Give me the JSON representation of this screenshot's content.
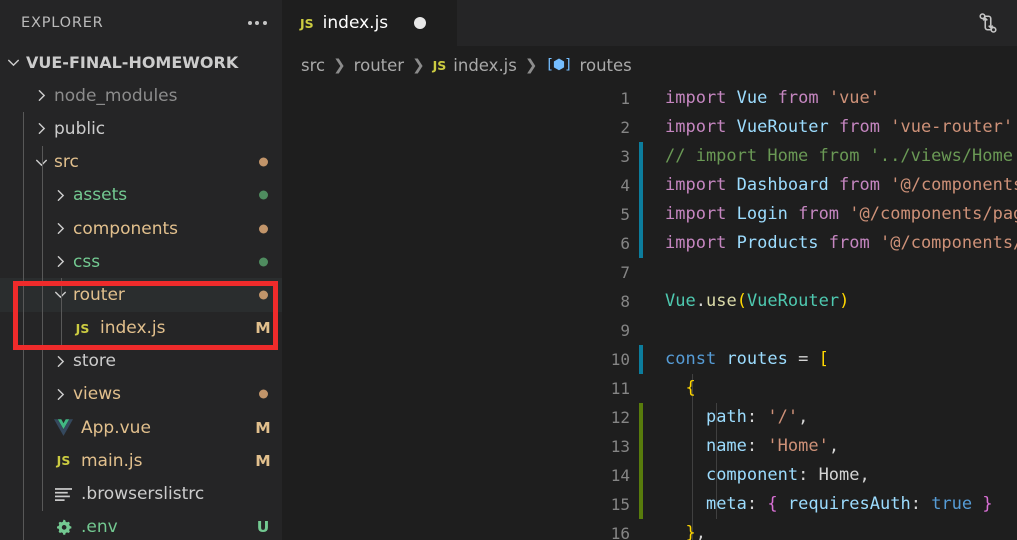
{
  "sidebar": {
    "title": "EXPLORER",
    "more_actions_label": "...",
    "root": {
      "label": "VUE-FINAL-HOMEWORK",
      "expanded": true
    },
    "items": [
      {
        "label": "node_modules",
        "type": "folder",
        "expanded": false,
        "indent": 1,
        "color": "#8c8c8c",
        "status": "",
        "dot": ""
      },
      {
        "label": "public",
        "type": "folder",
        "expanded": false,
        "indent": 1,
        "color": "#cccccc",
        "status": "",
        "dot": ""
      },
      {
        "label": "src",
        "type": "folder",
        "expanded": true,
        "indent": 1,
        "color": "#e2c08d",
        "status": "",
        "dot": "#c2956a"
      },
      {
        "label": "assets",
        "type": "folder",
        "expanded": false,
        "indent": 2,
        "color": "#73c991",
        "status": "",
        "dot": "#4f8c5f"
      },
      {
        "label": "components",
        "type": "folder",
        "expanded": false,
        "indent": 2,
        "color": "#e2c08d",
        "status": "",
        "dot": "#c2956a"
      },
      {
        "label": "css",
        "type": "folder",
        "expanded": false,
        "indent": 2,
        "color": "#73c991",
        "status": "",
        "dot": "#4f8c5f"
      },
      {
        "label": "router",
        "type": "folder",
        "expanded": true,
        "indent": 2,
        "color": "#e2c08d",
        "status": "",
        "dot": "#c2956a",
        "highlighted": true
      },
      {
        "label": "index.js",
        "type": "file",
        "icon": "JS",
        "icon_color": "#cbcb41",
        "indent": 3,
        "color": "#e2c08d",
        "status": "M",
        "status_color": "#e2c08d"
      },
      {
        "label": "store",
        "type": "folder",
        "expanded": false,
        "indent": 2,
        "color": "#cccccc",
        "status": "",
        "dot": ""
      },
      {
        "label": "views",
        "type": "folder",
        "expanded": false,
        "indent": 2,
        "color": "#e2c08d",
        "status": "",
        "dot": "#c2956a"
      },
      {
        "label": "App.vue",
        "type": "file",
        "icon": "vue",
        "icon_color": "#41b883",
        "indent": 2,
        "color": "#e2c08d",
        "status": "M",
        "status_color": "#e2c08d"
      },
      {
        "label": "main.js",
        "type": "file",
        "icon": "JS",
        "icon_color": "#cbcb41",
        "indent": 2,
        "color": "#e2c08d",
        "status": "M",
        "status_color": "#e2c08d"
      },
      {
        "label": ".browserslistrc",
        "type": "file",
        "icon": "lines",
        "icon_color": "#cccccc",
        "indent": 2,
        "color": "#cccccc",
        "status": "",
        "dot": ""
      },
      {
        "label": ".env",
        "type": "file",
        "icon": "gear",
        "icon_color": "#73c991",
        "indent": 2,
        "color": "#73c991",
        "status": "U",
        "status_color": "#73c991"
      }
    ]
  },
  "editor": {
    "tab": {
      "icon": "JS",
      "label": "index.js",
      "dirty": true
    },
    "actions": {
      "split_editor_label": "compare-changes-icon"
    },
    "breadcrumb": [
      {
        "text": "src",
        "icon": ""
      },
      {
        "text": "router",
        "icon": ""
      },
      {
        "text": "index.js",
        "icon": "JS"
      },
      {
        "text": "routes",
        "icon": "symbol-variable"
      }
    ],
    "lines": [
      {
        "n": 1,
        "gutter": "",
        "tokens": [
          {
            "t": "import ",
            "c": "kw"
          },
          {
            "t": "Vue",
            "c": "id"
          },
          {
            "t": " ",
            "c": "plain"
          },
          {
            "t": "from",
            "c": "kw"
          },
          {
            "t": " ",
            "c": "plain"
          },
          {
            "t": "'vue'",
            "c": "str"
          }
        ]
      },
      {
        "n": 2,
        "gutter": "",
        "tokens": [
          {
            "t": "import ",
            "c": "kw"
          },
          {
            "t": "VueRouter",
            "c": "id"
          },
          {
            "t": " ",
            "c": "plain"
          },
          {
            "t": "from",
            "c": "kw"
          },
          {
            "t": " ",
            "c": "plain"
          },
          {
            "t": "'vue-router'",
            "c": "str"
          }
        ]
      },
      {
        "n": 3,
        "gutter": "mod",
        "tokens": [
          {
            "t": "// import Home from '../views/Home.vue'",
            "c": "cmt"
          }
        ]
      },
      {
        "n": 4,
        "gutter": "mod",
        "tokens": [
          {
            "t": "import ",
            "c": "kw"
          },
          {
            "t": "Dashboard",
            "c": "id"
          },
          {
            "t": " ",
            "c": "plain"
          },
          {
            "t": "from",
            "c": "kw"
          },
          {
            "t": " ",
            "c": "plain"
          },
          {
            "t": "'@/components/Dashboard.vue'",
            "c": "str"
          }
        ]
      },
      {
        "n": 5,
        "gutter": "mod",
        "tokens": [
          {
            "t": "import ",
            "c": "kw"
          },
          {
            "t": "Login",
            "c": "id"
          },
          {
            "t": " ",
            "c": "plain"
          },
          {
            "t": "from",
            "c": "kw"
          },
          {
            "t": " ",
            "c": "plain"
          },
          {
            "t": "'@/components/pages/Login.vue'",
            "c": "str"
          }
        ]
      },
      {
        "n": 6,
        "gutter": "mod",
        "tokens": [
          {
            "t": "import ",
            "c": "kw"
          },
          {
            "t": "Products",
            "c": "id"
          },
          {
            "t": " ",
            "c": "plain"
          },
          {
            "t": "from",
            "c": "kw"
          },
          {
            "t": " ",
            "c": "plain"
          },
          {
            "t": "'@/components/pages/Products.vue'",
            "c": "str"
          }
        ]
      },
      {
        "n": 7,
        "gutter": "",
        "tokens": []
      },
      {
        "n": 8,
        "gutter": "",
        "tokens": [
          {
            "t": "Vue",
            "c": "cls"
          },
          {
            "t": ".",
            "c": "plain"
          },
          {
            "t": "use",
            "c": "fn"
          },
          {
            "t": "(",
            "c": "yellowp"
          },
          {
            "t": "VueRouter",
            "c": "cls"
          },
          {
            "t": ")",
            "c": "yellowp"
          }
        ]
      },
      {
        "n": 9,
        "gutter": "",
        "tokens": []
      },
      {
        "n": 10,
        "gutter": "mod",
        "tokens": [
          {
            "t": "const",
            "c": "blue"
          },
          {
            "t": " ",
            "c": "plain"
          },
          {
            "t": "routes",
            "c": "id"
          },
          {
            "t": " = ",
            "c": "plain"
          },
          {
            "t": "[",
            "c": "yellowp"
          }
        ],
        "guides": []
      },
      {
        "n": 11,
        "gutter": "",
        "tokens": [
          {
            "t": "  ",
            "c": "plain"
          },
          {
            "t": "{",
            "c": "yellowp"
          }
        ],
        "guides": [
          410
        ]
      },
      {
        "n": 12,
        "gutter": "add",
        "tokens": [
          {
            "t": "    ",
            "c": "plain"
          },
          {
            "t": "path",
            "c": "id"
          },
          {
            "t": ": ",
            "c": "plain"
          },
          {
            "t": "'/'",
            "c": "str"
          },
          {
            "t": ",",
            "c": "plain"
          }
        ],
        "guides": [
          410,
          434
        ]
      },
      {
        "n": 13,
        "gutter": "add",
        "tokens": [
          {
            "t": "    ",
            "c": "plain"
          },
          {
            "t": "name",
            "c": "id"
          },
          {
            "t": ": ",
            "c": "plain"
          },
          {
            "t": "'Home'",
            "c": "str"
          },
          {
            "t": ",",
            "c": "plain"
          }
        ],
        "guides": [
          410,
          434
        ]
      },
      {
        "n": 14,
        "gutter": "add",
        "tokens": [
          {
            "t": "    ",
            "c": "plain"
          },
          {
            "t": "component",
            "c": "id"
          },
          {
            "t": ": ",
            "c": "plain"
          },
          {
            "t": "Home",
            "c": "plain"
          },
          {
            "t": ",",
            "c": "plain"
          }
        ],
        "guides": [
          410,
          434
        ]
      },
      {
        "n": 15,
        "gutter": "add",
        "tokens": [
          {
            "t": "    ",
            "c": "plain"
          },
          {
            "t": "meta",
            "c": "id"
          },
          {
            "t": ": ",
            "c": "plain"
          },
          {
            "t": "{",
            "c": "purplep"
          },
          {
            "t": " ",
            "c": "plain"
          },
          {
            "t": "requiresAuth",
            "c": "id"
          },
          {
            "t": ": ",
            "c": "plain"
          },
          {
            "t": "true",
            "c": "blue"
          },
          {
            "t": " ",
            "c": "plain"
          },
          {
            "t": "}",
            "c": "purplep"
          }
        ],
        "guides": [
          410,
          434
        ]
      },
      {
        "n": 16,
        "gutter": "",
        "tokens": [
          {
            "t": "  ",
            "c": "plain"
          },
          {
            "t": "}",
            "c": "yellowp"
          },
          {
            "t": ",",
            "c": "plain"
          }
        ],
        "guides": [
          410
        ]
      }
    ]
  },
  "annotation": {
    "highlight_color": "#ef2b2b",
    "target": "router/index.js"
  }
}
